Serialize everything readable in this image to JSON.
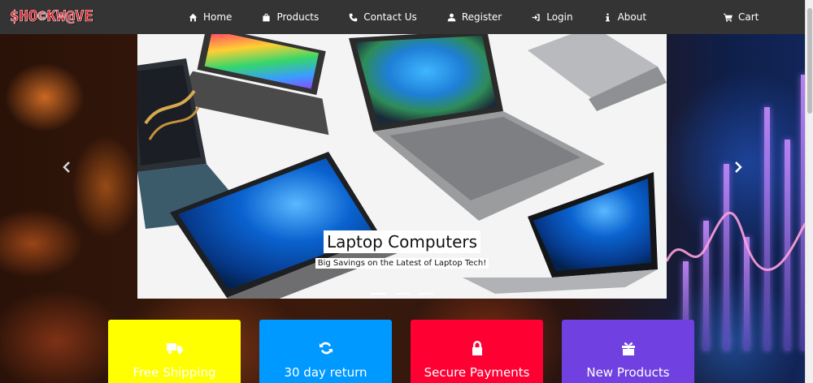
{
  "brand": {
    "logo_text": "$HO©KW@VE"
  },
  "nav": {
    "items": [
      {
        "label": "Home",
        "icon": "home-icon"
      },
      {
        "label": "Products",
        "icon": "shopping-bag-icon"
      },
      {
        "label": "Contact Us",
        "icon": "phone-icon"
      },
      {
        "label": "Register",
        "icon": "user-icon"
      },
      {
        "label": "Login",
        "icon": "sign-in-icon"
      },
      {
        "label": "About",
        "icon": "info-icon"
      }
    ],
    "cart": {
      "label": "Cart",
      "icon": "cart-icon"
    }
  },
  "carousel": {
    "slide": {
      "title": "Laptop Computers",
      "subtitle": "Big Savings on the Latest of Laptop Tech!"
    },
    "slide_count": 3,
    "active_index": 0
  },
  "features": [
    {
      "label": "Free Shipping",
      "icon": "truck-icon",
      "color": "#ffff00"
    },
    {
      "label": "30 day return",
      "icon": "refresh-icon",
      "color": "#0099ff"
    },
    {
      "label": "Secure Payments",
      "icon": "lock-icon",
      "color": "#ff0033"
    },
    {
      "label": "New Products",
      "icon": "gift-icon",
      "color": "#7040e0"
    }
  ],
  "colors": {
    "navbar": "#343434",
    "logo_red": "#d21f2a"
  }
}
